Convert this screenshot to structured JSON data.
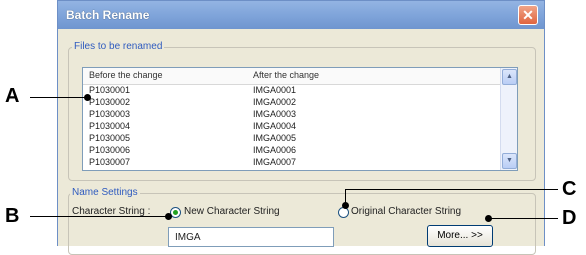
{
  "window": {
    "title": "Batch Rename",
    "close_glyph": "✕"
  },
  "files_group": {
    "label": "Files to be renamed"
  },
  "list": {
    "columns": [
      "Before the change",
      "After the change"
    ],
    "rows": [
      [
        "P1030001",
        "IMGA0001"
      ],
      [
        "P1030002",
        "IMGA0002"
      ],
      [
        "P1030003",
        "IMGA0003"
      ],
      [
        "P1030004",
        "IMGA0004"
      ],
      [
        "P1030005",
        "IMGA0005"
      ],
      [
        "P1030006",
        "IMGA0006"
      ],
      [
        "P1030007",
        "IMGA0007"
      ]
    ],
    "scroll_up_glyph": "▲",
    "scroll_down_glyph": "▼"
  },
  "name_settings": {
    "label": "Name Settings",
    "char_string_label": "Character String :",
    "option_new": "New Character String",
    "option_original": "Original Character String",
    "selected": "new",
    "input_value": "IMGA",
    "more_button": "More... >>"
  },
  "callouts": {
    "a": "A",
    "b": "B",
    "c": "C",
    "d": "D"
  }
}
